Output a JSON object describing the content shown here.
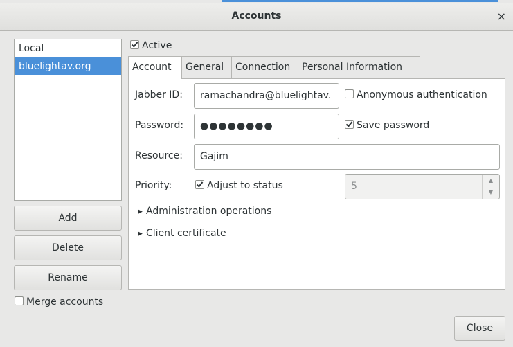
{
  "window": {
    "title": "Accounts",
    "close_glyph": "×"
  },
  "accounts": {
    "items": [
      {
        "label": "Local",
        "selected": false
      },
      {
        "label": "bluelightav.org",
        "selected": true
      }
    ],
    "add_label": "Add",
    "delete_label": "Delete",
    "rename_label": "Rename",
    "merge_label": "Merge accounts",
    "merge_checked": false
  },
  "active": {
    "label": "Active",
    "checked": true
  },
  "tabs": [
    {
      "label": "Account",
      "active": true
    },
    {
      "label": "General",
      "active": false
    },
    {
      "label": "Connection",
      "active": false
    },
    {
      "label": "Personal Information",
      "active": false
    }
  ],
  "account_tab": {
    "jid_label": "Jabber ID:",
    "jid_value": "ramachandra@bluelightav.",
    "anon_label": "Anonymous authentication",
    "anon_checked": false,
    "password_label": "Password:",
    "password_value": "●●●●●●●●",
    "save_password_label": "Save password",
    "save_password_checked": true,
    "resource_label": "Resource:",
    "resource_value": "Gajim",
    "priority_label": "Priority:",
    "adjust_label": "Adjust to status",
    "adjust_checked": true,
    "priority_value": "5",
    "admin_label": "Administration operations",
    "cert_label": "Client certificate"
  },
  "footer": {
    "close_label": "Close"
  },
  "icons": {
    "expander": "triangle-right-icon",
    "spin_up": "▲",
    "spin_down": "▼",
    "expander_glyph": "▶"
  },
  "colors": {
    "selection": "#4a90d9",
    "window_bg": "#e8e8e7"
  }
}
